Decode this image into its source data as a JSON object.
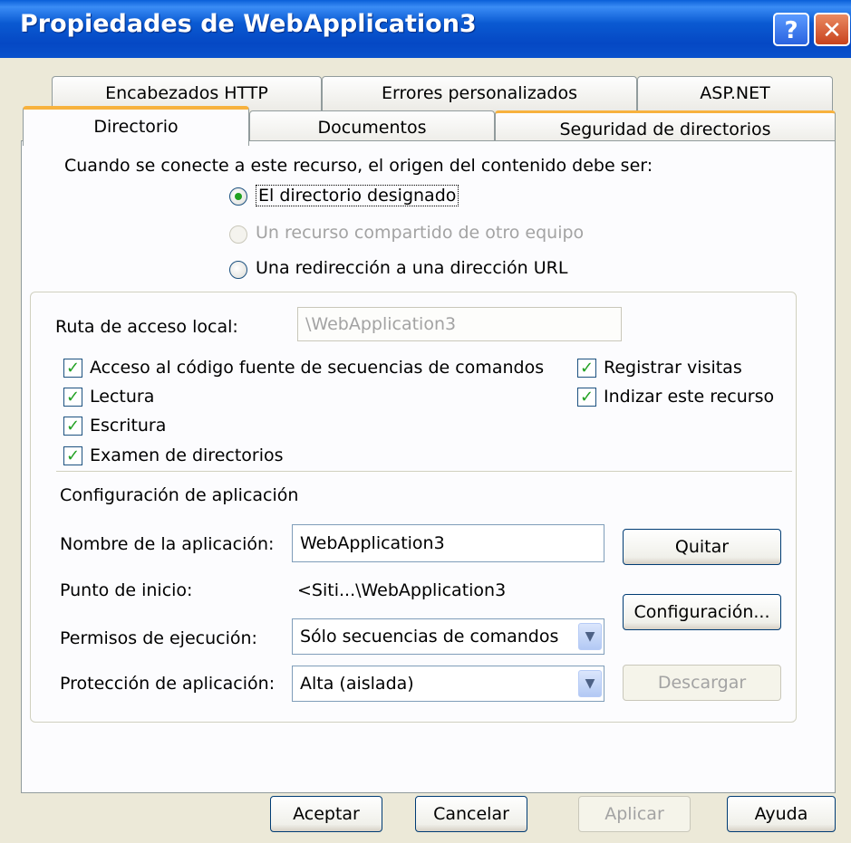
{
  "window": {
    "title": "Propiedades de WebApplication3",
    "help_glyph": "?",
    "close_glyph": "✕"
  },
  "tabs_back": [
    "Encabezados HTTP",
    "Errores personalizados",
    "ASP.NET"
  ],
  "tabs_front": [
    "Directorio",
    "Documentos",
    "Seguridad de directorios"
  ],
  "active_tab": "Directorio",
  "source": {
    "prompt": "Cuando se conecte a este recurso, el origen del contenido debe ser:",
    "options": [
      {
        "label": "El directorio designado",
        "selected": true,
        "enabled": true
      },
      {
        "label": "Un recurso compartido de otro equipo",
        "selected": false,
        "enabled": false
      },
      {
        "label": "Una redirección a una dirección URL",
        "selected": false,
        "enabled": true
      }
    ]
  },
  "local_path": {
    "label": "Ruta de acceso local:",
    "value": "\\WebApplication3"
  },
  "checkboxes": [
    {
      "label": "Acceso al código fuente de secuencias de comandos",
      "checked": true
    },
    {
      "label": "Lectura",
      "checked": true
    },
    {
      "label": "Escritura",
      "checked": true
    },
    {
      "label": "Examen de directorios",
      "checked": true
    },
    {
      "label": "Registrar visitas",
      "checked": true
    },
    {
      "label": "Indizar este recurso",
      "checked": true
    }
  ],
  "app_config": {
    "heading": "Configuración de aplicación",
    "name_label": "Nombre de la aplicación:",
    "name_value": "WebApplication3",
    "start_label": "Punto de inicio:",
    "start_value": "<Siti...\\WebApplication3",
    "exec_label": "Permisos de ejecución:",
    "exec_value": "Sólo secuencias de comandos",
    "protection_label": "Protección de aplicación:",
    "protection_value": "Alta (aislada)",
    "remove_button": "Quitar",
    "config_button": "Configuración...",
    "unload_button": "Descargar"
  },
  "footer": {
    "ok": "Aceptar",
    "cancel": "Cancelar",
    "apply": "Aplicar",
    "help": "Ayuda"
  },
  "colors": {
    "title_bar": "#0a52cc",
    "active_tab_accent": "#f7b23e",
    "check_mark": "#21a121",
    "dialog_bg": "#ece9d8"
  }
}
